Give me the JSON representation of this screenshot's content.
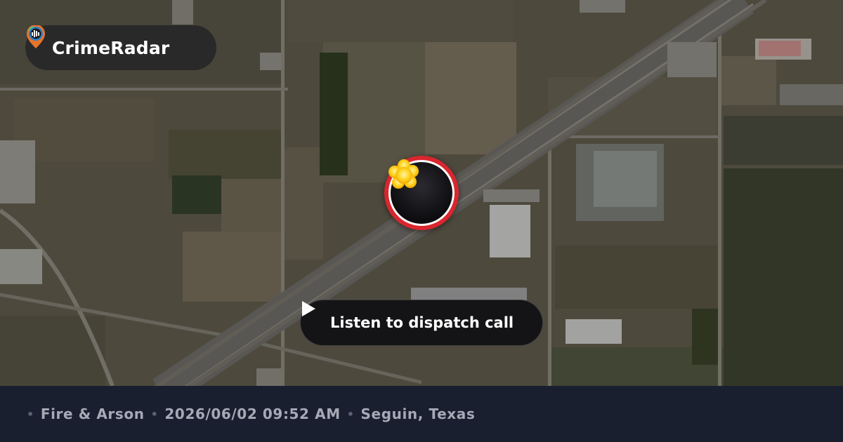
{
  "brand": {
    "name": "CrimeRadar",
    "logo_icon": "radar-pin-icon"
  },
  "map": {
    "type": "satellite",
    "marker_icon": "fire-burst-icon",
    "marker_color": "#d9262e"
  },
  "dispatch_button": {
    "label": "Listen to dispatch call",
    "icon": "play-icon"
  },
  "footer": {
    "separator": "•",
    "category": "Fire & Arson",
    "datetime": "2026/06/02 09:52 AM",
    "location": "Seguin, Texas"
  }
}
